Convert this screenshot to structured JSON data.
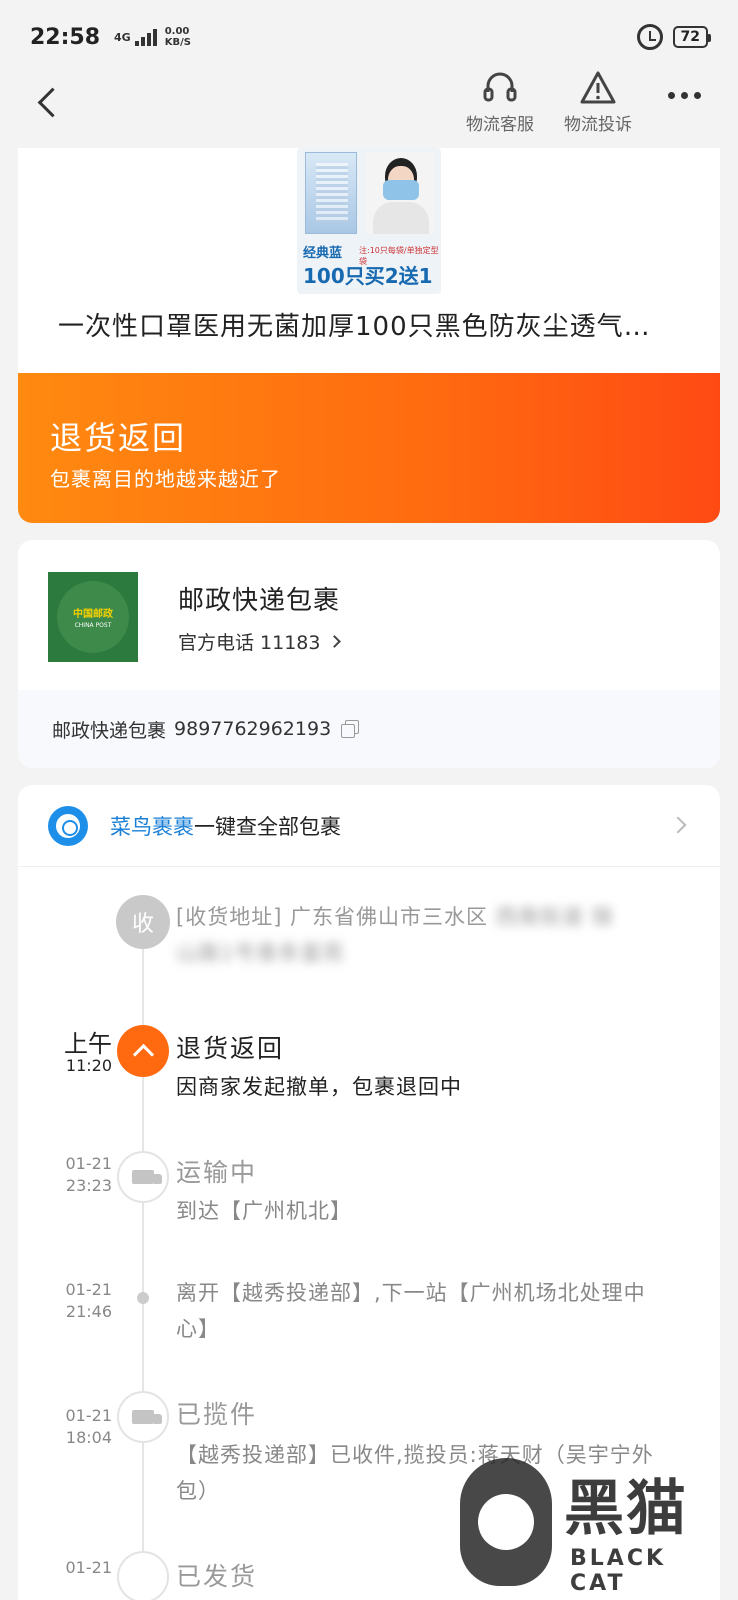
{
  "status_bar": {
    "time": "22:58",
    "network": "4G",
    "speed_value": "0.00",
    "speed_unit": "KB/S",
    "battery": "72"
  },
  "nav": {
    "customer_service": "物流客服",
    "complaint": "物流投诉"
  },
  "product": {
    "title": "一次性口罩医用无菌加厚100只黑色防灰尘透气…",
    "promo_line1": "经典蓝",
    "promo_note": "注:10只每袋/单独定型袋",
    "promo_line2": "100只买2送1"
  },
  "status": {
    "title": "退货返回",
    "subtitle": "包裹离目的地越来越近了"
  },
  "courier": {
    "name": "邮政快递包裹",
    "phone_label": "官方电话 11183",
    "logo_cn": "中国邮政",
    "logo_en": "CHINA POST",
    "tracking_label": "邮政快递包裹",
    "tracking_number": "9897762962193"
  },
  "cainiao": {
    "brand": "菜鸟裹裹",
    "text": "一键查全部包裹"
  },
  "timeline": {
    "recv_node": "收",
    "recv_address_visible": "[收货地址] 广东省佛山市三水区",
    "events": [
      {
        "date": "上午",
        "time": "11:20",
        "title": "退货返回",
        "desc": "因商家发起撤单，包裹退回中"
      },
      {
        "date": "01-21",
        "time": "23:23",
        "title": "运输中",
        "desc": "到达【广州机北】"
      },
      {
        "date": "01-21",
        "time": "21:46",
        "title": "",
        "desc": "离开【越秀投递部】,下一站【广州机场北处理中心】"
      },
      {
        "date": "01-21",
        "time": "18:04",
        "title": "已揽件",
        "desc": "【越秀投递部】已收件,揽投员:蒋天财（吴宇宁外包）"
      },
      {
        "date": "01-21",
        "time": "",
        "title": "已发货",
        "desc": ""
      }
    ]
  },
  "watermark": {
    "cn": "黑猫",
    "en": "BLACK CAT"
  }
}
